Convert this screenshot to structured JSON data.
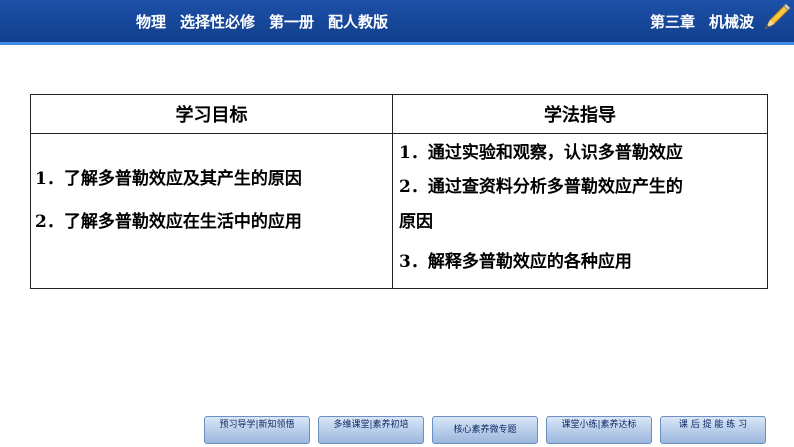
{
  "header": {
    "items": [
      "物理",
      "选择性必修",
      "第一册",
      "配人教版"
    ],
    "chapter": "第三章",
    "topic": "机械波",
    "bg_color": "#1a4fa3",
    "icon": "pencil-icon"
  },
  "table": {
    "headers": [
      "学习目标",
      "学法指导"
    ],
    "goals": [
      {
        "num": "1．",
        "text": "了解多普勒效应及其产生的原因"
      },
      {
        "num": "2．",
        "text": "了解多普勒效应在生活中的应用"
      }
    ],
    "guidance": [
      {
        "num": "1．",
        "text": "通过实验和观察，认识多普勒效应"
      },
      {
        "num": "2．",
        "text": "通过查资料分析多普勒效应产生的"
      },
      {
        "num": "",
        "text": "原因"
      },
      {
        "num": "3．",
        "text": "解释多普勒效应的各种应用"
      }
    ]
  },
  "nav": {
    "buttons": [
      "预习导学|新知领悟",
      "多维课堂|素养初培",
      "核心素养微专题",
      "课堂小练|素养达标",
      "课 后 提 能 练 习"
    ]
  }
}
